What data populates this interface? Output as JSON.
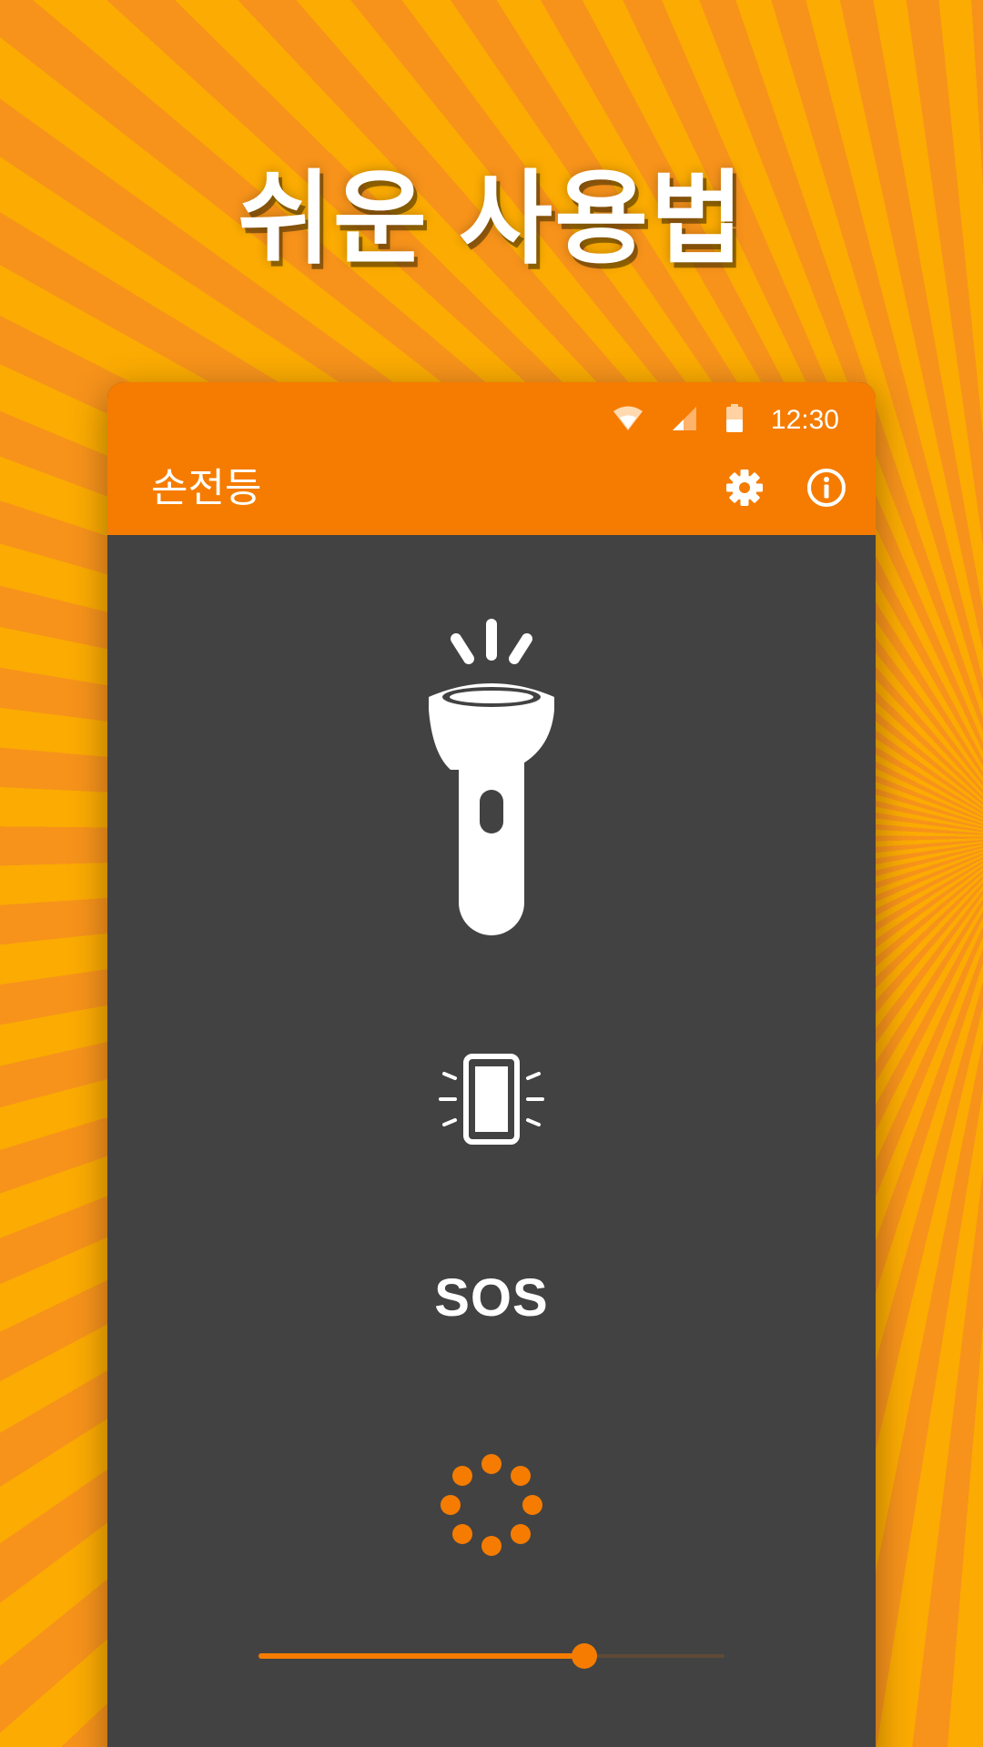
{
  "headline": "쉬운 사용법",
  "status_bar": {
    "time": "12:30",
    "icons": [
      "wifi-icon",
      "cellular-signal-icon",
      "battery-icon"
    ]
  },
  "app_bar": {
    "title": "손전등",
    "actions": [
      "settings-icon",
      "info-icon"
    ]
  },
  "main": {
    "flashlight_icon": "flashlight-icon",
    "screen_light_icon": "screen-light-icon",
    "sos_label": "SOS",
    "strobe_icon": "strobe-icon",
    "brightness_slider": {
      "value_fraction": 0.7
    }
  },
  "colors": {
    "accent": "#f57c00",
    "content_background": "#424242",
    "background_stripe_a": "#f7931b",
    "background_stripe_b": "#fbab02"
  }
}
